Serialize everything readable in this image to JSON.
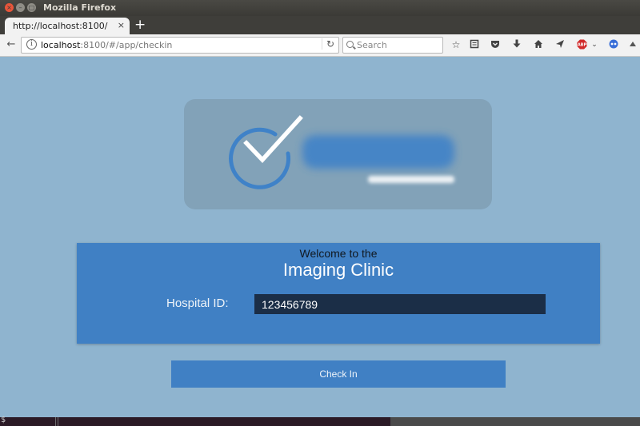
{
  "window": {
    "title": "Mozilla Firefox"
  },
  "tab": {
    "title": "http://localhost:8100/",
    "close_glyph": "×",
    "new_tab_glyph": "+"
  },
  "nav": {
    "url_host": "localhost",
    "url_rest": ":8100/#/app/checkin",
    "search_placeholder": "Search",
    "toolbar_icons": [
      "bookmark-star-icon",
      "reading-list-icon",
      "pocket-icon",
      "download-icon",
      "home-icon",
      "share-icon",
      "adblock-plus-icon",
      "dropdown-chevron-icon",
      "extension-icon",
      "extension-icon-2"
    ]
  },
  "logo": {
    "accent_color": "#3f82c8",
    "check_color": "#ffffff"
  },
  "welcome": {
    "pre_text": "Welcome to the",
    "clinic_name": "Imaging Clinic"
  },
  "form": {
    "hospital_id_label": "Hospital ID:",
    "hospital_id_value": "123456789"
  },
  "actions": {
    "check_in_label": "Check In"
  },
  "terminal": {
    "prompt": "$"
  }
}
